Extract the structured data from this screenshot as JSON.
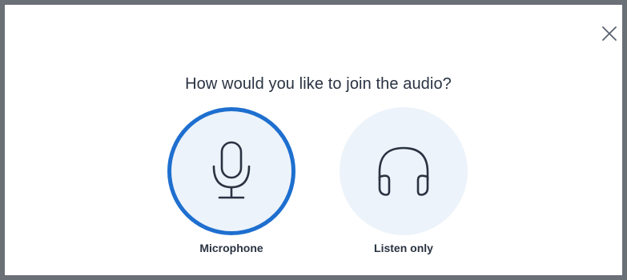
{
  "dialog": {
    "title": "How would you like to join the audio?",
    "close_icon": "close-icon"
  },
  "options": [
    {
      "label": "Microphone",
      "icon": "microphone-icon",
      "selected": true
    },
    {
      "label": "Listen only",
      "icon": "headphones-icon",
      "selected": false
    }
  ],
  "colors": {
    "accent": "#1e6fcf",
    "option_background": "#edf3fa",
    "icon_stroke": "#2a3342",
    "text": "#2a3342",
    "border": "#6b7077"
  }
}
